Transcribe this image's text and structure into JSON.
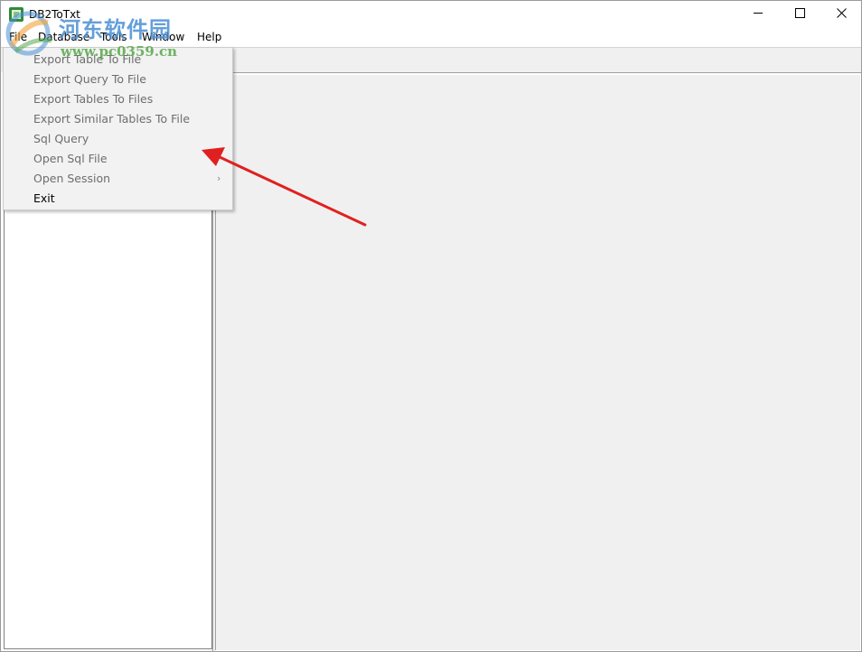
{
  "window": {
    "title": "DB2ToTxt"
  },
  "menubar": {
    "items": [
      "File",
      "Database",
      "Tools",
      "Window",
      "Help"
    ]
  },
  "file_menu": {
    "items": [
      {
        "label": "Export Table To File",
        "enabled": false
      },
      {
        "label": "Export Query To File",
        "enabled": false
      },
      {
        "label": "Export Tables To Files",
        "enabled": false
      },
      {
        "label": "Export Similar Tables To File",
        "enabled": false
      },
      {
        "label": "Sql Query",
        "enabled": false
      },
      {
        "label": "Open Sql File",
        "enabled": false
      },
      {
        "label": "Open Session",
        "enabled": false,
        "has_submenu": true
      },
      {
        "label": "Exit",
        "enabled": true
      }
    ],
    "submenu_arrow": "›"
  },
  "watermark": {
    "site_name": "河东软件园",
    "url": "www.pc0359.cn"
  },
  "colors": {
    "disabled_text": "#6d6d6d",
    "annotation_arrow": "#e02020",
    "watermark_blue": "#4a8fd4",
    "watermark_green": "#57a84a"
  },
  "icons": {
    "app": "app-icon",
    "minimize": "minimize-icon",
    "maximize": "maximize-icon",
    "close": "close-icon"
  }
}
